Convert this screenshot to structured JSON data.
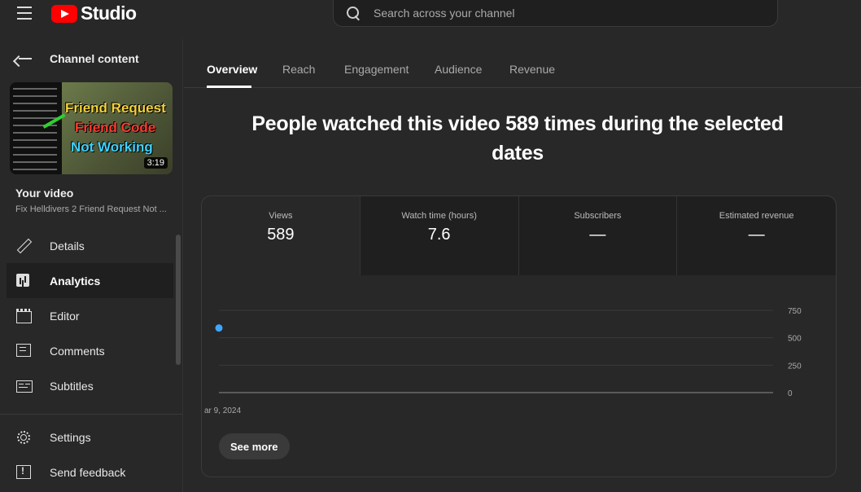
{
  "app": {
    "logo_text": "Studio"
  },
  "search": {
    "placeholder": "Search across your channel"
  },
  "sidebar": {
    "back_label": "Channel content",
    "thumbnail": {
      "line1": "Friend Request",
      "line2": "Friend Code",
      "line3": "Not Working",
      "duration": "3:19"
    },
    "your_video_label": "Your video",
    "video_title": "Fix Helldivers 2 Friend Request Not ...",
    "items": [
      {
        "label": "Details",
        "icon": "pencil-icon",
        "active": false
      },
      {
        "label": "Analytics",
        "icon": "analytics-icon",
        "active": true
      },
      {
        "label": "Editor",
        "icon": "clapper-icon",
        "active": false
      },
      {
        "label": "Comments",
        "icon": "comment-icon",
        "active": false
      },
      {
        "label": "Subtitles",
        "icon": "subtitles-icon",
        "active": false
      }
    ],
    "bottom_items": [
      {
        "label": "Settings",
        "icon": "gear-icon"
      },
      {
        "label": "Send feedback",
        "icon": "feedback-icon"
      }
    ]
  },
  "tabs": [
    {
      "label": "Overview",
      "active": true
    },
    {
      "label": "Reach",
      "active": false
    },
    {
      "label": "Engagement",
      "active": false
    },
    {
      "label": "Audience",
      "active": false
    },
    {
      "label": "Revenue",
      "active": false
    }
  ],
  "headline": "People watched this video 589 times during the selected dates",
  "metrics": [
    {
      "label": "Views",
      "value": "589"
    },
    {
      "label": "Watch time (hours)",
      "value": "7.6"
    },
    {
      "label": "Subscribers",
      "value": "—"
    },
    {
      "label": "Estimated revenue",
      "value": "—"
    }
  ],
  "chart_data": {
    "type": "line",
    "x": [
      "ar 9, 2024"
    ],
    "series": [
      {
        "values": [
          589
        ]
      }
    ],
    "y_ticks": [
      "750",
      "500",
      "250",
      "0"
    ],
    "ylim": [
      0,
      750
    ],
    "x_tick_label": "ar 9, 2024",
    "point_color": "#3ea6ff"
  },
  "see_more_label": "See more"
}
